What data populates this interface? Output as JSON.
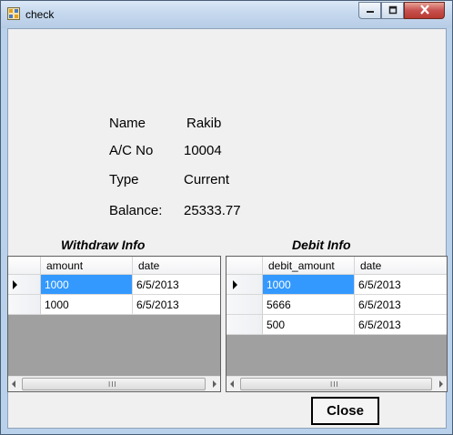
{
  "window": {
    "title": "check",
    "icon": "app-form-icon",
    "controls": {
      "minimize_icon": "minimize-icon",
      "maximize_icon": "maximize-icon",
      "close_icon": "close-icon"
    }
  },
  "account": {
    "name_label": "Name",
    "name_value": "Rakib",
    "acno_label": "A/C No",
    "acno_value": "10004",
    "type_label": "Type",
    "type_value": "Current",
    "balance_label": "Balance:",
    "balance_value": "25333.77"
  },
  "withdraw": {
    "title": "Withdraw Info",
    "columns": [
      "amount",
      "date"
    ],
    "rows": [
      [
        "1000",
        "6/5/2013"
      ],
      [
        "1000",
        "6/5/2013"
      ]
    ],
    "scroll_grip": "III"
  },
  "debit": {
    "title": "Debit Info",
    "columns": [
      "debit_amount",
      "date"
    ],
    "rows": [
      [
        "1000",
        "6/5/2013"
      ],
      [
        "5666",
        "6/5/2013"
      ],
      [
        "500",
        "6/5/2013"
      ]
    ],
    "scroll_grip": "III"
  },
  "buttons": {
    "close_label": "Close"
  },
  "colors": {
    "selection": "#3399ff",
    "grid_empty": "#a0a0a0",
    "window_frame": "#b9d1ea"
  }
}
